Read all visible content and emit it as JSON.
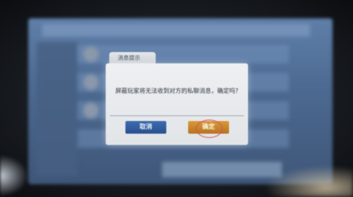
{
  "dialog": {
    "title": "消息提示",
    "message": "屏蔽玩家将无法收到对方的私聊消息，确定吗？",
    "cancel_label": "取消",
    "confirm_label": "确定"
  }
}
